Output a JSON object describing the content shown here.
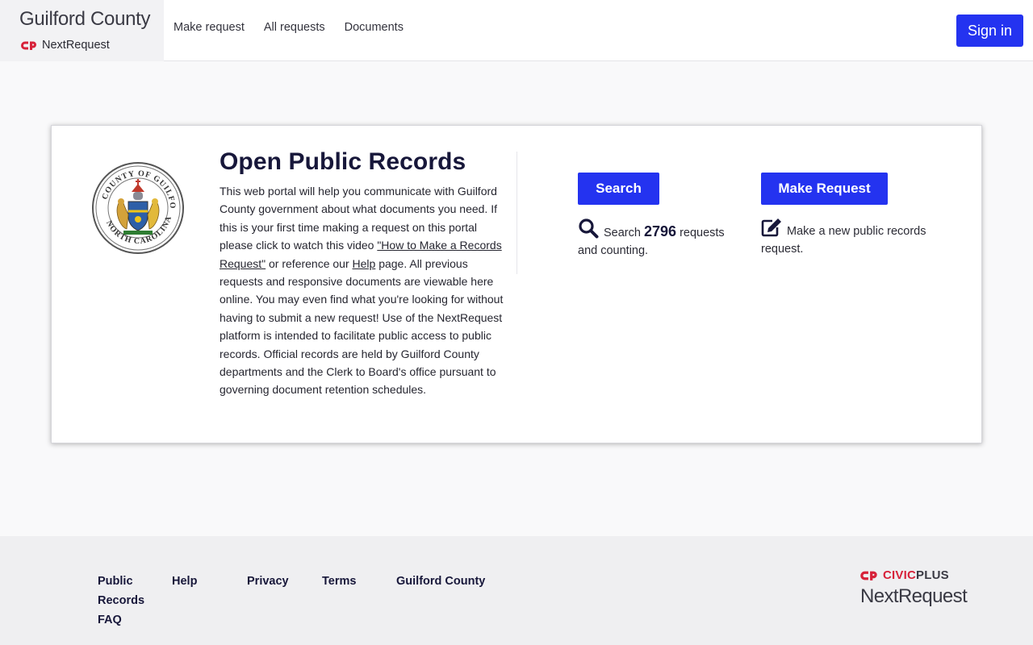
{
  "header": {
    "brand_title": "Guilford County",
    "brand_sub": "NextRequest",
    "nav": [
      "Make request",
      "All requests",
      "Documents"
    ],
    "sign_in": "Sign in"
  },
  "card": {
    "seal_label": "County of Guilford North Carolina seal",
    "title": "Open Public Records",
    "intro_1": "This web portal will help you communicate with Guilford County government about what documents you need. If this is your first time making a request on this portal please click to watch this video ",
    "video_link": "\"How to Make a Records Request\"",
    "intro_2": " or reference our ",
    "help_link": "Help",
    "intro_3": " page.  All previous requests and responsive documents are viewable here online. You may even find what you're looking for without having to submit a new request!  Use of the NextRequest platform is intended to facilitate public access to public records. Official records are held by Guilford County departments and the Clerk to Board's office pursuant to governing document retention schedules.",
    "search": {
      "button": "Search",
      "prefix": "Search",
      "count": "2796",
      "suffix": "requests and counting."
    },
    "make": {
      "button": "Make Request",
      "desc": "Make a new public records request."
    }
  },
  "footer": {
    "links": [
      "Public Records FAQ",
      "Help",
      "Privacy",
      "Terms",
      "Guilford County"
    ],
    "logo_top_1": "CIVIC",
    "logo_top_2": "PLUS",
    "logo_bottom": "NextRequest"
  },
  "colors": {
    "accent": "#2433f0",
    "heading": "#17173a",
    "brand_red": "#d7223a"
  },
  "icons": [
    "civicplus-logo-icon",
    "search-icon",
    "edit-icon",
    "county-seal"
  ]
}
